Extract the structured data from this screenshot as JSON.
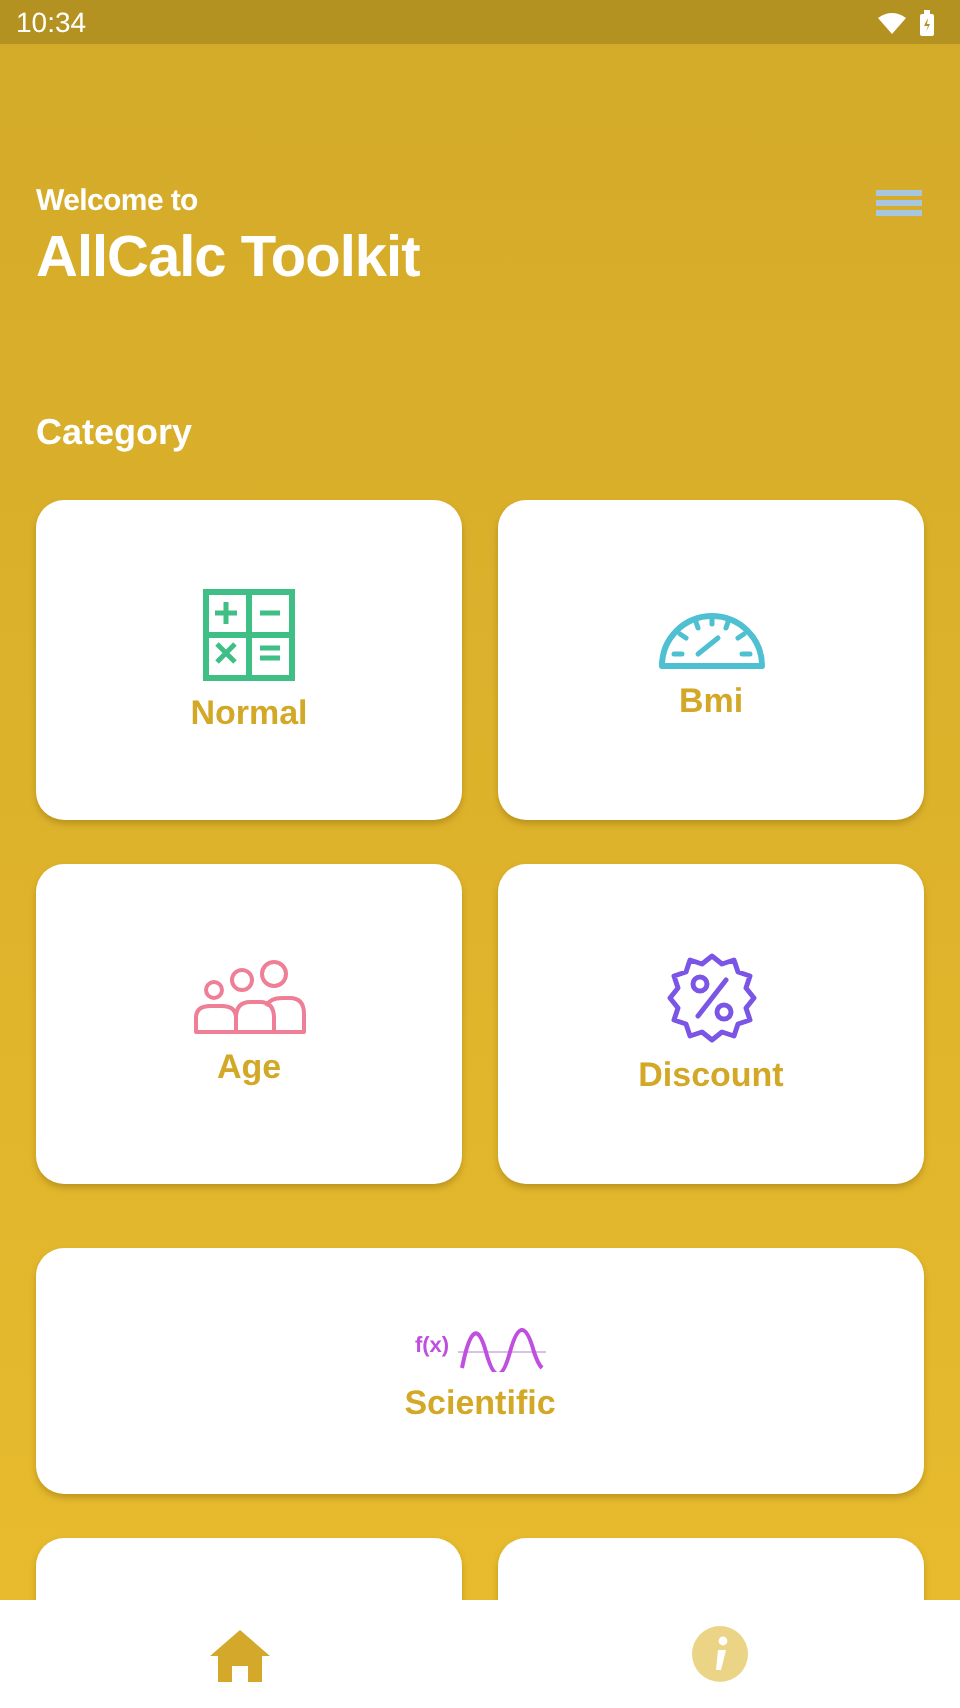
{
  "status_bar": {
    "time": "10:34"
  },
  "header": {
    "greeting": "Welcome to",
    "title": "AllCalc Toolkit"
  },
  "section_title": "Category",
  "cards": [
    {
      "kind": "calculator",
      "label": "Normal",
      "wide": false
    },
    {
      "kind": "gauge",
      "label": "Bmi",
      "wide": false
    },
    {
      "kind": "people",
      "label": "Age",
      "wide": false
    },
    {
      "kind": "discount",
      "label": "Discount",
      "wide": false
    },
    {
      "kind": "function",
      "label": "Scientific",
      "wide": true,
      "icon_text": "f(x)"
    },
    {
      "kind": "blank",
      "wide": false
    },
    {
      "kind": "blank",
      "wide": false
    }
  ],
  "bottom_nav": [
    {
      "kind": "home",
      "selected": true
    },
    {
      "kind": "info",
      "selected": false
    }
  ]
}
